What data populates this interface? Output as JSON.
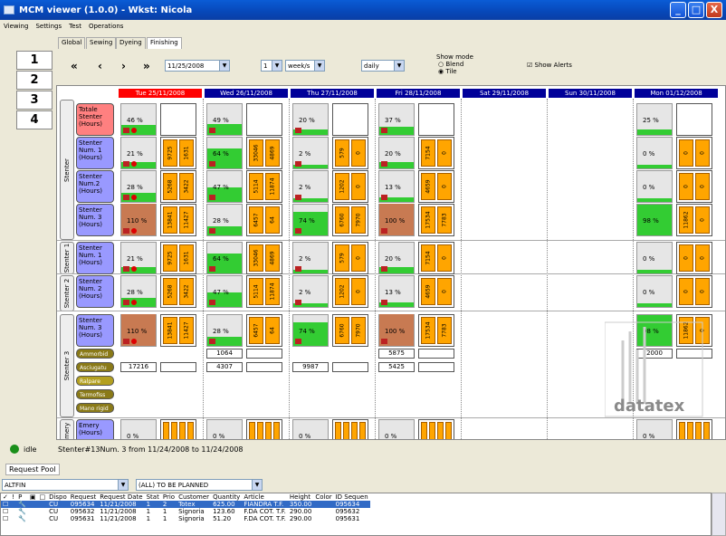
{
  "window": {
    "title": "MCM viewer (1.0.0) - Wkst: Nicola",
    "min": "_",
    "max": "□",
    "close": "X"
  },
  "menu": [
    "Viewing",
    "Settings",
    "Test",
    "Operations"
  ],
  "numtabs": [
    "1",
    "2",
    "3",
    "4"
  ],
  "tabs": [
    "Global",
    "Sewing",
    "Dyeing",
    "Finishing"
  ],
  "nav": {
    "first": "«",
    "prev": "‹",
    "next": "›",
    "last": "»",
    "date": "11/25/2008",
    "count": "1",
    "unit": "week/s",
    "period": "daily",
    "show_mode": "Show mode",
    "blend": "Blend",
    "tile": "Tile",
    "alerts": "Show Alerts"
  },
  "days": [
    {
      "label": "Tue 25/11/2008",
      "color": "#ff0000"
    },
    {
      "label": "Wed 26/11/2008",
      "color": "#000099"
    },
    {
      "label": "Thu 27/11/2008",
      "color": "#000099"
    },
    {
      "label": "Fri 28/11/2008",
      "color": "#000099"
    },
    {
      "label": "Sat 29/11/2008",
      "color": "#000099"
    },
    {
      "label": "Sun 30/11/2008",
      "color": "#000099"
    },
    {
      "label": "Mon 01/12/2008",
      "color": "#000099"
    }
  ],
  "groups": [
    "Stenter",
    "Stenter 1",
    "Stenter 2",
    "Stenter 3",
    "Emery"
  ],
  "rows": {
    "r0": "Totale Stenter (Hours)",
    "r1": "Stenter Num. 1 (Hours)",
    "r2": "Stenter Num.2 (Hours)",
    "r3": "Stenter Num. 3 (Hours)",
    "r4": "Stenter Num. 1 (Hours)",
    "r5": "Stenter Num. 2 (Hours)",
    "r6": "Stenter Num. 3 (Hours)",
    "r7": "Emery (Hours)"
  },
  "pills": [
    "Ammorbid",
    "Asciugatu",
    "Ralpare",
    "Termofiss",
    "Mano rigid"
  ],
  "cells": {
    "c00": "46 %",
    "c01": "49 %",
    "c02": "20 %",
    "c03": "37 %",
    "c06": "25 %",
    "c10": "21 %",
    "c11": "64 %",
    "c12": "2 %",
    "c13": "20 %",
    "c16": "0 %",
    "c20": "28 %",
    "c21": "47 %",
    "c22": "2 %",
    "c23": "13 %",
    "c26": "0 %",
    "c30": "110 %",
    "c31": "28 %",
    "c32": "74 %",
    "c33": "100 %",
    "c36": "98 %",
    "c40": "21 %",
    "c41": "64 %",
    "c42": "2 %",
    "c43": "20 %",
    "c46": "0 %",
    "c50": "28 %",
    "c51": "47 %",
    "c52": "2 %",
    "c53": "13 %",
    "c56": "0 %",
    "c60": "110 %",
    "c61": "28 %",
    "c62": "74 %",
    "c63": "100 %",
    "c66": "98 %",
    "c70": "0 %",
    "c71": "0 %",
    "c72": "0 %",
    "c73": "0 %",
    "c76": "0 %"
  },
  "bars": {
    "b10": [
      "9725",
      "1631"
    ],
    "b11": [
      "33046",
      "4869"
    ],
    "b12": [
      "579",
      "0"
    ],
    "b13": [
      "7154",
      "0"
    ],
    "b16": [
      "0",
      "0"
    ],
    "b20": [
      "5268",
      "3422"
    ],
    "b21": [
      "5114",
      "11874"
    ],
    "b22": [
      "1202",
      "0"
    ],
    "b23": [
      "4659",
      "0"
    ],
    "b26": [
      "0",
      "0"
    ],
    "b30": [
      "13841",
      "11427"
    ],
    "b31": [
      "6457",
      "64"
    ],
    "b32": [
      "6760",
      "7970"
    ],
    "b33": [
      "17534",
      "7783"
    ],
    "b36": [
      "11862",
      "0"
    ]
  },
  "vals": {
    "v61": "1064",
    "v63": "5875",
    "v66": "2000",
    "v70": "17216",
    "v71": "4307",
    "v72": "9987",
    "v73": "5425"
  },
  "status": {
    "state": "idle",
    "text": "Stenter#13Num. 3 from 11/24/2008 to 11/24/2008"
  },
  "pool": {
    "title": "Request Pool",
    "filter1": "ALTFIN",
    "filter2": "(ALL) TO BE PLANNED",
    "headers": [
      "Dispo",
      "Request",
      "Request Date",
      "Stat",
      "Prio",
      "Customer",
      "Quantity",
      "Article",
      "Height",
      "Color",
      "ID Sequen"
    ],
    "rows": [
      [
        "CU",
        "095634",
        "11/21/2008",
        "1",
        "2",
        "Totex",
        "625.00",
        "FIANDRA T.F.",
        "350.00",
        "",
        "095634"
      ],
      [
        "CU",
        "095632",
        "11/21/2008",
        "1",
        "1",
        "Signoria",
        "123.60",
        "F.DA COT. T.F.",
        "290.00",
        "",
        "095632"
      ],
      [
        "CU",
        "095631",
        "11/21/2008",
        "1",
        "1",
        "Signoria",
        "51.20",
        "F.DA COT. T.F.",
        "290.00",
        "",
        "095631"
      ]
    ]
  },
  "logo": "datatex"
}
